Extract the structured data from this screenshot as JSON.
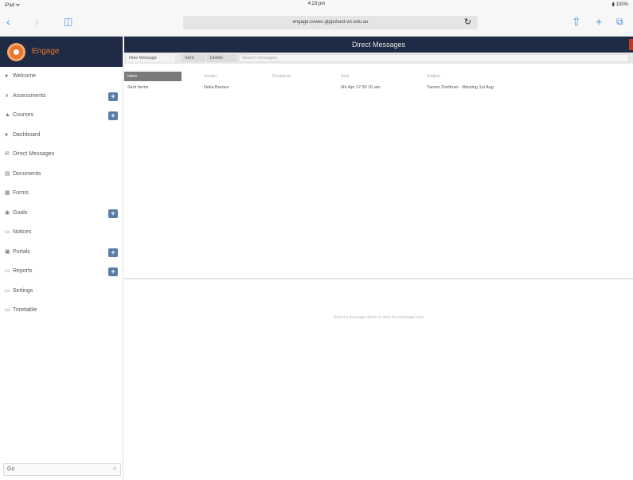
{
  "status": {
    "carrier": "iPad ᯤ",
    "time": "4:23 pm",
    "battery": "▮ 100%"
  },
  "browser": {
    "url": "engage.cowes.gippsland.vic.edu.au",
    "reload": "↻",
    "icons": {
      "back": "‹",
      "forward": "›",
      "bookmarks": "◫",
      "share": "⇧",
      "new_tab": "+",
      "tabs": "⧉"
    }
  },
  "app": {
    "brand": "Engage",
    "title": "Direct Messages",
    "accent": "#e8772e",
    "nav_bg": "#1f2a44"
  },
  "sidebar": {
    "items": [
      {
        "label": "Welcome",
        "icon": "●",
        "expandable": false
      },
      {
        "label": "Assessments",
        "icon": "∨",
        "expandable": true
      },
      {
        "label": "Courses",
        "icon": "▲",
        "expandable": true
      },
      {
        "label": "Dashboard",
        "icon": "●",
        "expandable": false
      },
      {
        "label": "Direct Messages",
        "icon": "✉",
        "expandable": false
      },
      {
        "label": "Documents",
        "icon": "▤",
        "expandable": false
      },
      {
        "label": "Forms",
        "icon": "▦",
        "expandable": false
      },
      {
        "label": "Goals",
        "icon": "◉",
        "expandable": true
      },
      {
        "label": "Notices",
        "icon": "▭",
        "expandable": false
      },
      {
        "label": "Portals",
        "icon": "▣",
        "expandable": true
      },
      {
        "label": "Reports",
        "icon": "▭",
        "expandable": true
      },
      {
        "label": "Settings",
        "icon": "▭",
        "expandable": false
      },
      {
        "label": "Timetable",
        "icon": "▭",
        "expandable": false
      }
    ],
    "expand_symbol": "+",
    "search": {
      "value": "Go",
      "clear": "×"
    }
  },
  "toolbar": {
    "new_message": "New Message",
    "btn_a": "Sent",
    "btn_b": "Delete",
    "search_placeholder": "Search messages"
  },
  "table": {
    "headers": [
      "Inbox",
      "Sender",
      "Recipients",
      "Sent",
      "Subject"
    ],
    "rows": [
      [
        "Sent Items",
        "Nelia Barnes",
        "",
        "6th Apr 17:30 10 am",
        "Tanner Dorfman - Wasting 1st Aug"
      ]
    ]
  },
  "preview": {
    "empty_message": "Select a message above to view the message here"
  }
}
